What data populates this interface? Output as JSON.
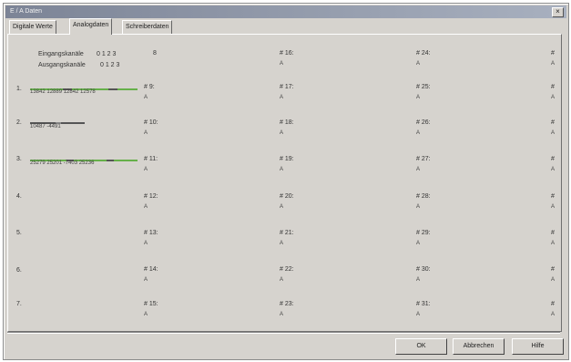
{
  "window": {
    "title": "E / A Daten",
    "close_glyph": "×"
  },
  "tabs": [
    {
      "label": "Digitale Werte"
    },
    {
      "label": "Analogdaten"
    },
    {
      "label": "Schreiberdaten"
    }
  ],
  "header": {
    "input_label": "Eingangskanäle",
    "input_values": "0 1 2 3",
    "output_label": "Ausgangskanäle",
    "output_values": "0 1 2 3",
    "top_marker": "8"
  },
  "rows": [
    {
      "label": "1.",
      "values": "13842   12889   12842   12578"
    },
    {
      "label": "2.",
      "values": "10487   -4491"
    },
    {
      "label": "3.",
      "values": "25279   25201   -7403   25236"
    },
    {
      "label": "4.",
      "values": ""
    },
    {
      "label": "5.",
      "values": ""
    },
    {
      "label": "6.",
      "values": ""
    },
    {
      "label": "7.",
      "values": ""
    }
  ],
  "columns": {
    "col1": [
      "# 9:",
      "# 10:",
      "# 11:",
      "# 12:",
      "# 13:",
      "# 14:",
      "# 15:"
    ],
    "col2": [
      "# 16:",
      "# 17:",
      "# 18:",
      "# 19:",
      "# 20:",
      "# 21:",
      "# 22:",
      "# 23:"
    ],
    "col3": [
      "# 24:",
      "# 25:",
      "# 26:",
      "# 27:",
      "# 28:",
      "# 29:",
      "# 30:",
      "# 31:"
    ],
    "col4": [
      "#",
      "#",
      "#",
      "#",
      "#",
      "#",
      "#",
      "#"
    ],
    "sub": "A"
  },
  "buttons": {
    "ok": "OK",
    "cancel": "Abbrechen",
    "help": "Hilfe"
  },
  "colors": {
    "bar_green": "#66b04a",
    "bar_gray": "#555555"
  }
}
